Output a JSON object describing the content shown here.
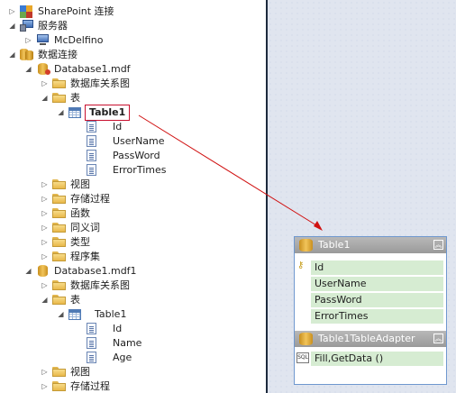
{
  "explorer": {
    "sharepoint": "SharePoint 连接",
    "servers": "服务器",
    "server_name": "McDelfino",
    "data_connections": "数据连接",
    "db1": {
      "name": "Database1.mdf",
      "diagrams": "数据库关系图",
      "tables": "表",
      "table_name": "Table1",
      "columns": [
        "Id",
        "UserName",
        "PassWord",
        "ErrorTimes"
      ],
      "views": "视图",
      "procs": "存储过程",
      "functions": "函数",
      "synonyms": "同义词",
      "types": "类型",
      "assemblies": "程序集"
    },
    "db2": {
      "name": "Database1.mdf1",
      "diagrams": "数据库关系图",
      "tables": "表",
      "table_name": "Table1",
      "columns": [
        "Id",
        "Name",
        "Age"
      ],
      "views": "视图",
      "procs": "存储过程"
    }
  },
  "designer": {
    "table_title": "Table1",
    "fields": [
      "Id",
      "UserName",
      "PassWord",
      "ErrorTimes"
    ],
    "adapter_title": "Table1TableAdapter",
    "query": "Fill,GetData ()",
    "colors": {
      "header": "#a8a8a8",
      "field_bg": "#d6ecd2",
      "arrow": "#d01010",
      "border": "#6f98cf"
    }
  }
}
